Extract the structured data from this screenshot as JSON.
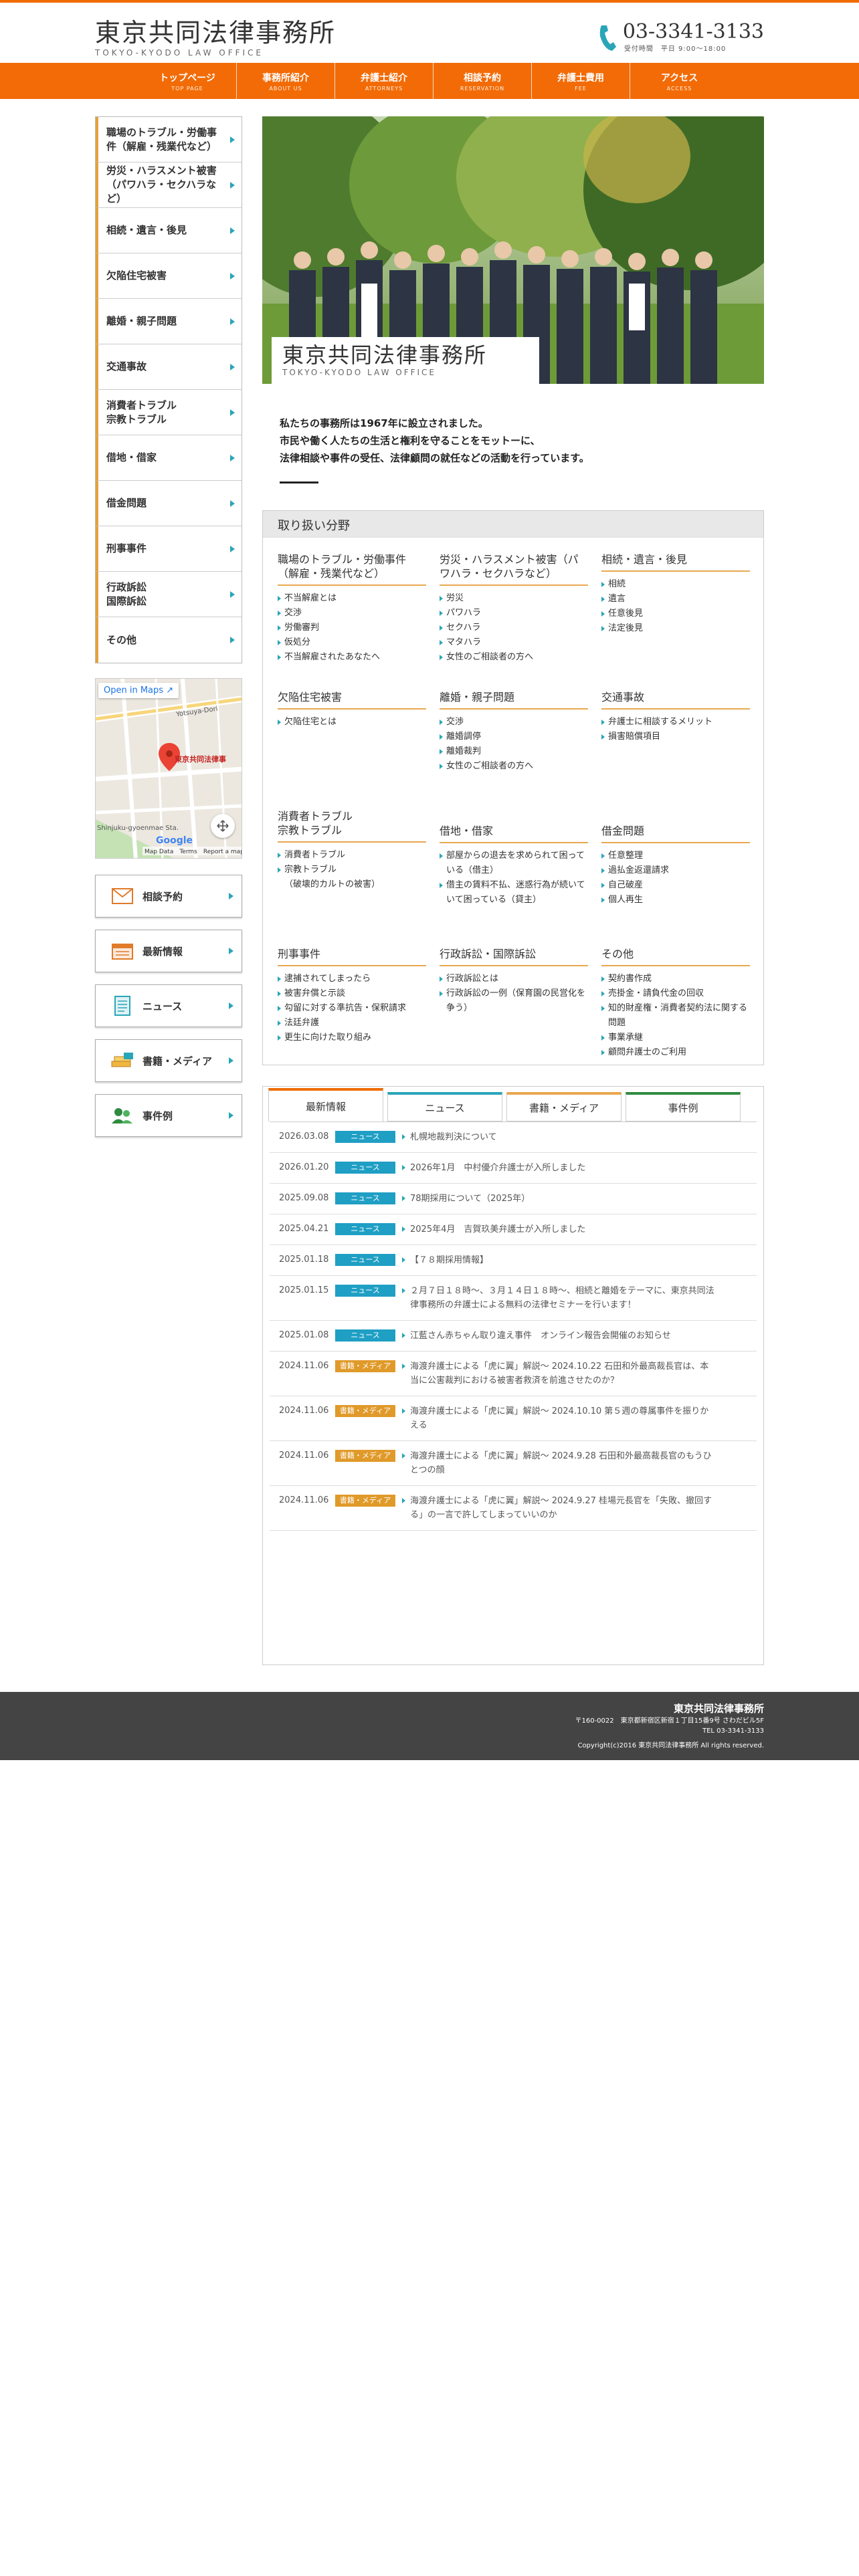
{
  "header": {
    "logo_main": "東京共同法律事務所",
    "logo_sub": "TOKYO-KYODO LAW OFFICE",
    "phone": "03-3341-3133",
    "hours": "受付時間　平日 9:00～18:00",
    "phone_icon": "phone-icon"
  },
  "nav": {
    "items": [
      {
        "jp": "トップページ",
        "en": "TOP PAGE"
      },
      {
        "jp": "事務所紹介",
        "en": "ABOUT US"
      },
      {
        "jp": "弁護士紹介",
        "en": "ATTORNEYS"
      },
      {
        "jp": "相談予約",
        "en": "RESERVATION"
      },
      {
        "jp": "弁護士費用",
        "en": "FEE"
      },
      {
        "jp": "アクセス",
        "en": "ACCESS"
      }
    ]
  },
  "sidebar": {
    "items": [
      {
        "label": "職場のトラブル・労働事件（解雇・残業代など）"
      },
      {
        "label": "労災・ハラスメント被害（パワハラ・セクハラなど）"
      },
      {
        "label": "相続・遺言・後見"
      },
      {
        "label": "欠陥住宅被害"
      },
      {
        "label": "離婚・親子問題"
      },
      {
        "label": "交通事故"
      },
      {
        "label": "消費者トラブル\n宗教トラブル"
      },
      {
        "label": "借地・借家"
      },
      {
        "label": "借金問題"
      },
      {
        "label": "刑事事件"
      },
      {
        "label": "行政訴訟\n国際訴訟"
      },
      {
        "label": "その他"
      }
    ],
    "map": {
      "open_link": "Open in Maps",
      "place_label": "東京共同法律事",
      "google": "Google",
      "footer": "Map Data　Terms　Report a map error",
      "street1": "Yotsuya-Dori",
      "street2": "Shinjuku-gyoenmae Sta."
    },
    "quick": [
      {
        "label": "相談予約",
        "icon": "mail-icon"
      },
      {
        "label": "最新情報",
        "icon": "calendar-icon"
      },
      {
        "label": "ニュース",
        "icon": "document-icon"
      },
      {
        "label": "書籍・メディア",
        "icon": "books-icon"
      },
      {
        "label": "事件例",
        "icon": "people-icon"
      }
    ]
  },
  "hero": {
    "title": "東京共同法律事務所",
    "sub": "TOKYO-KYODO LAW OFFICE"
  },
  "intro": {
    "line1": "私たちの事務所は1967年に設立されました。",
    "line2": "市民や働く人たちの生活と権利を守ることをモットーに、",
    "line3": "法律相談や事件の受任、法律顧問の就任などの活動を行っています。"
  },
  "practice": {
    "heading": "取り扱い分野",
    "areas": [
      {
        "title": "職場のトラブル・労働事件（解雇・残業代など）",
        "items": [
          "不当解雇とは",
          "交渉",
          "労働審判",
          "仮処分",
          "不当解雇されたあなたへ"
        ]
      },
      {
        "title": "労災・ハラスメント被害（パワハラ・セクハラなど）",
        "items": [
          "労災",
          "パワハラ",
          "セクハラ",
          "マタハラ",
          "女性のご相談者の方へ"
        ]
      },
      {
        "title": "相続・遺言・後見",
        "items": [
          "相続",
          "遺言",
          "任意後見",
          "法定後見"
        ]
      },
      {
        "title": "欠陥住宅被害",
        "items": [
          "欠陥住宅とは"
        ]
      },
      {
        "title": "離婚・親子問題",
        "items": [
          "交渉",
          "離婚調停",
          "離婚裁判",
          "女性のご相談者の方へ"
        ]
      },
      {
        "title": "交通事故",
        "items": [
          "弁護士に相談するメリット",
          "損害賠償項目"
        ]
      },
      {
        "title": "消費者トラブル\n宗教トラブル",
        "items": [
          "消費者トラブル",
          "宗教トラブル\n（破壊的カルトの被害）"
        ]
      },
      {
        "title": "借地・借家",
        "items": [
          "部屋からの退去を求められて困っている（借主）",
          "借主の賃料不払、迷惑行為が続いていて困っている（貸主）"
        ]
      },
      {
        "title": "借金問題",
        "items": [
          "任意整理",
          "過払金返還請求",
          "自己破産",
          "個人再生"
        ]
      },
      {
        "title": "刑事事件",
        "items": [
          "逮捕されてしまったら",
          "被害弁償と示談",
          "勾留に対する準抗告・保釈請求",
          "法廷弁護",
          "更生に向けた取り組み"
        ]
      },
      {
        "title": "行政訴訟・国際訴訟",
        "items": [
          "行政訴訟とは",
          "行政訴訟の一例（保育園の民営化を争う）"
        ]
      },
      {
        "title": "その他",
        "items": [
          "契約書作成",
          "売掛金・請負代金の回収",
          "知的財産権・消費者契約法に関する問題",
          "事業承継",
          "顧問弁護士のご利用"
        ]
      }
    ]
  },
  "news": {
    "tabs": [
      "最新情報",
      "ニュース",
      "書籍・メディア",
      "事件例"
    ],
    "colors": {
      "news": "#1f9fc4",
      "media": "#e09a2a"
    },
    "rows": [
      {
        "date": "2026.03.08",
        "badge": "ニュース",
        "kind": "news",
        "title": "札幌地裁判決について"
      },
      {
        "date": "2026.01.20",
        "badge": "ニュース",
        "kind": "news",
        "title": "2026年1月　中村優介弁護士が入所しました"
      },
      {
        "date": "2025.09.08",
        "badge": "ニュース",
        "kind": "news",
        "title": "78期採用について（2025年）"
      },
      {
        "date": "2025.04.21",
        "badge": "ニュース",
        "kind": "news",
        "title": "2025年4月　吉賀玖美弁護士が入所しました"
      },
      {
        "date": "2025.01.18",
        "badge": "ニュース",
        "kind": "news",
        "title": "【７８期採用情報】"
      },
      {
        "date": "2025.01.15",
        "badge": "ニュース",
        "kind": "news",
        "title": "２月７日１８時〜、３月１４日１８時〜、相続と離婚をテーマに、東京共同法律事務所の弁護士による無料の法律セミナーを行います！"
      },
      {
        "date": "2025.01.08",
        "badge": "ニュース",
        "kind": "news",
        "title": "江藍さん赤ちゃん取り違え事件　オンライン報告会開催のお知らせ"
      },
      {
        "date": "2024.11.06",
        "badge": "書籍・メディア",
        "kind": "media",
        "title": "海渡弁護士による「虎に翼」解説〜 2024.10.22 石田和外最高裁長官は、本当に公害裁判における被害者救済を前進させたのか？"
      },
      {
        "date": "2024.11.06",
        "badge": "書籍・メディア",
        "kind": "media",
        "title": "海渡弁護士による「虎に翼」解説〜 2024.10.10 第５週の尊属事件を振りかえる"
      },
      {
        "date": "2024.11.06",
        "badge": "書籍・メディア",
        "kind": "media",
        "title": "海渡弁護士による「虎に翼」解説〜 2024.9.28 石田和外最高裁長官のもうひとつの顔"
      },
      {
        "date": "2024.11.06",
        "badge": "書籍・メディア",
        "kind": "media",
        "title": "海渡弁護士による「虎に翼」解説〜 2024.9.27 桂場元長官を「失敗、撤回する」の一言で許してしまっていいのか"
      }
    ]
  },
  "footer": {
    "name": "東京共同法律事務所",
    "address": "〒160-0022　東京都新宿区新宿１丁目15番9号 さわだビル5F",
    "tel": "TEL 03-3341-3133",
    "copyright": "Copyright(c)2016 東京共同法律事務所 All rights reserved."
  }
}
